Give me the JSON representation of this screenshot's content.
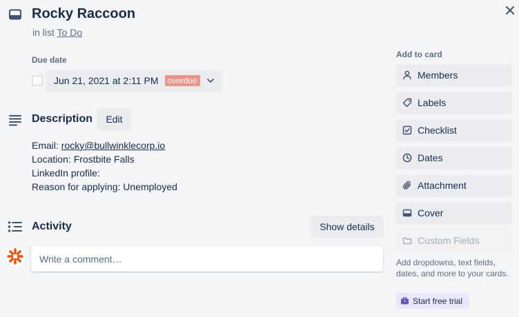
{
  "card": {
    "title": "Rocky Raccoon",
    "in_list_prefix": "in list",
    "list_name": "To Do"
  },
  "due": {
    "label": "Due date",
    "date_text": "Jun 21, 2021 at 2:11 PM",
    "badge": "overdue",
    "badge_color": "#ec9488",
    "checked": false
  },
  "description": {
    "title": "Description",
    "edit_label": "Edit",
    "email_label": "Email:",
    "email": "rocky@bullwinklecorp.io",
    "location": "Location: Frostbite Falls",
    "linkedin": "LinkedIn profile:",
    "reason": "Reason for applying: Unemployed"
  },
  "activity": {
    "title": "Activity",
    "show_details_label": "Show details",
    "comment_placeholder": "Write a comment…",
    "avatar_color": "#ff4a00"
  },
  "sidebar": {
    "title": "Add to card",
    "items": [
      {
        "label": "Members",
        "icon": "person-icon"
      },
      {
        "label": "Labels",
        "icon": "tag-icon"
      },
      {
        "label": "Checklist",
        "icon": "checkbox-icon"
      },
      {
        "label": "Dates",
        "icon": "clock-icon"
      },
      {
        "label": "Attachment",
        "icon": "paperclip-icon"
      },
      {
        "label": "Cover",
        "icon": "card-cover-icon"
      },
      {
        "label": "Custom Fields",
        "icon": "folder-icon",
        "disabled": true
      }
    ],
    "custom_fields_desc": "Add dropdowns, text fields, dates, and more to your cards.",
    "trial_label": "Start free trial",
    "trial_bg": "#eae6ff"
  }
}
